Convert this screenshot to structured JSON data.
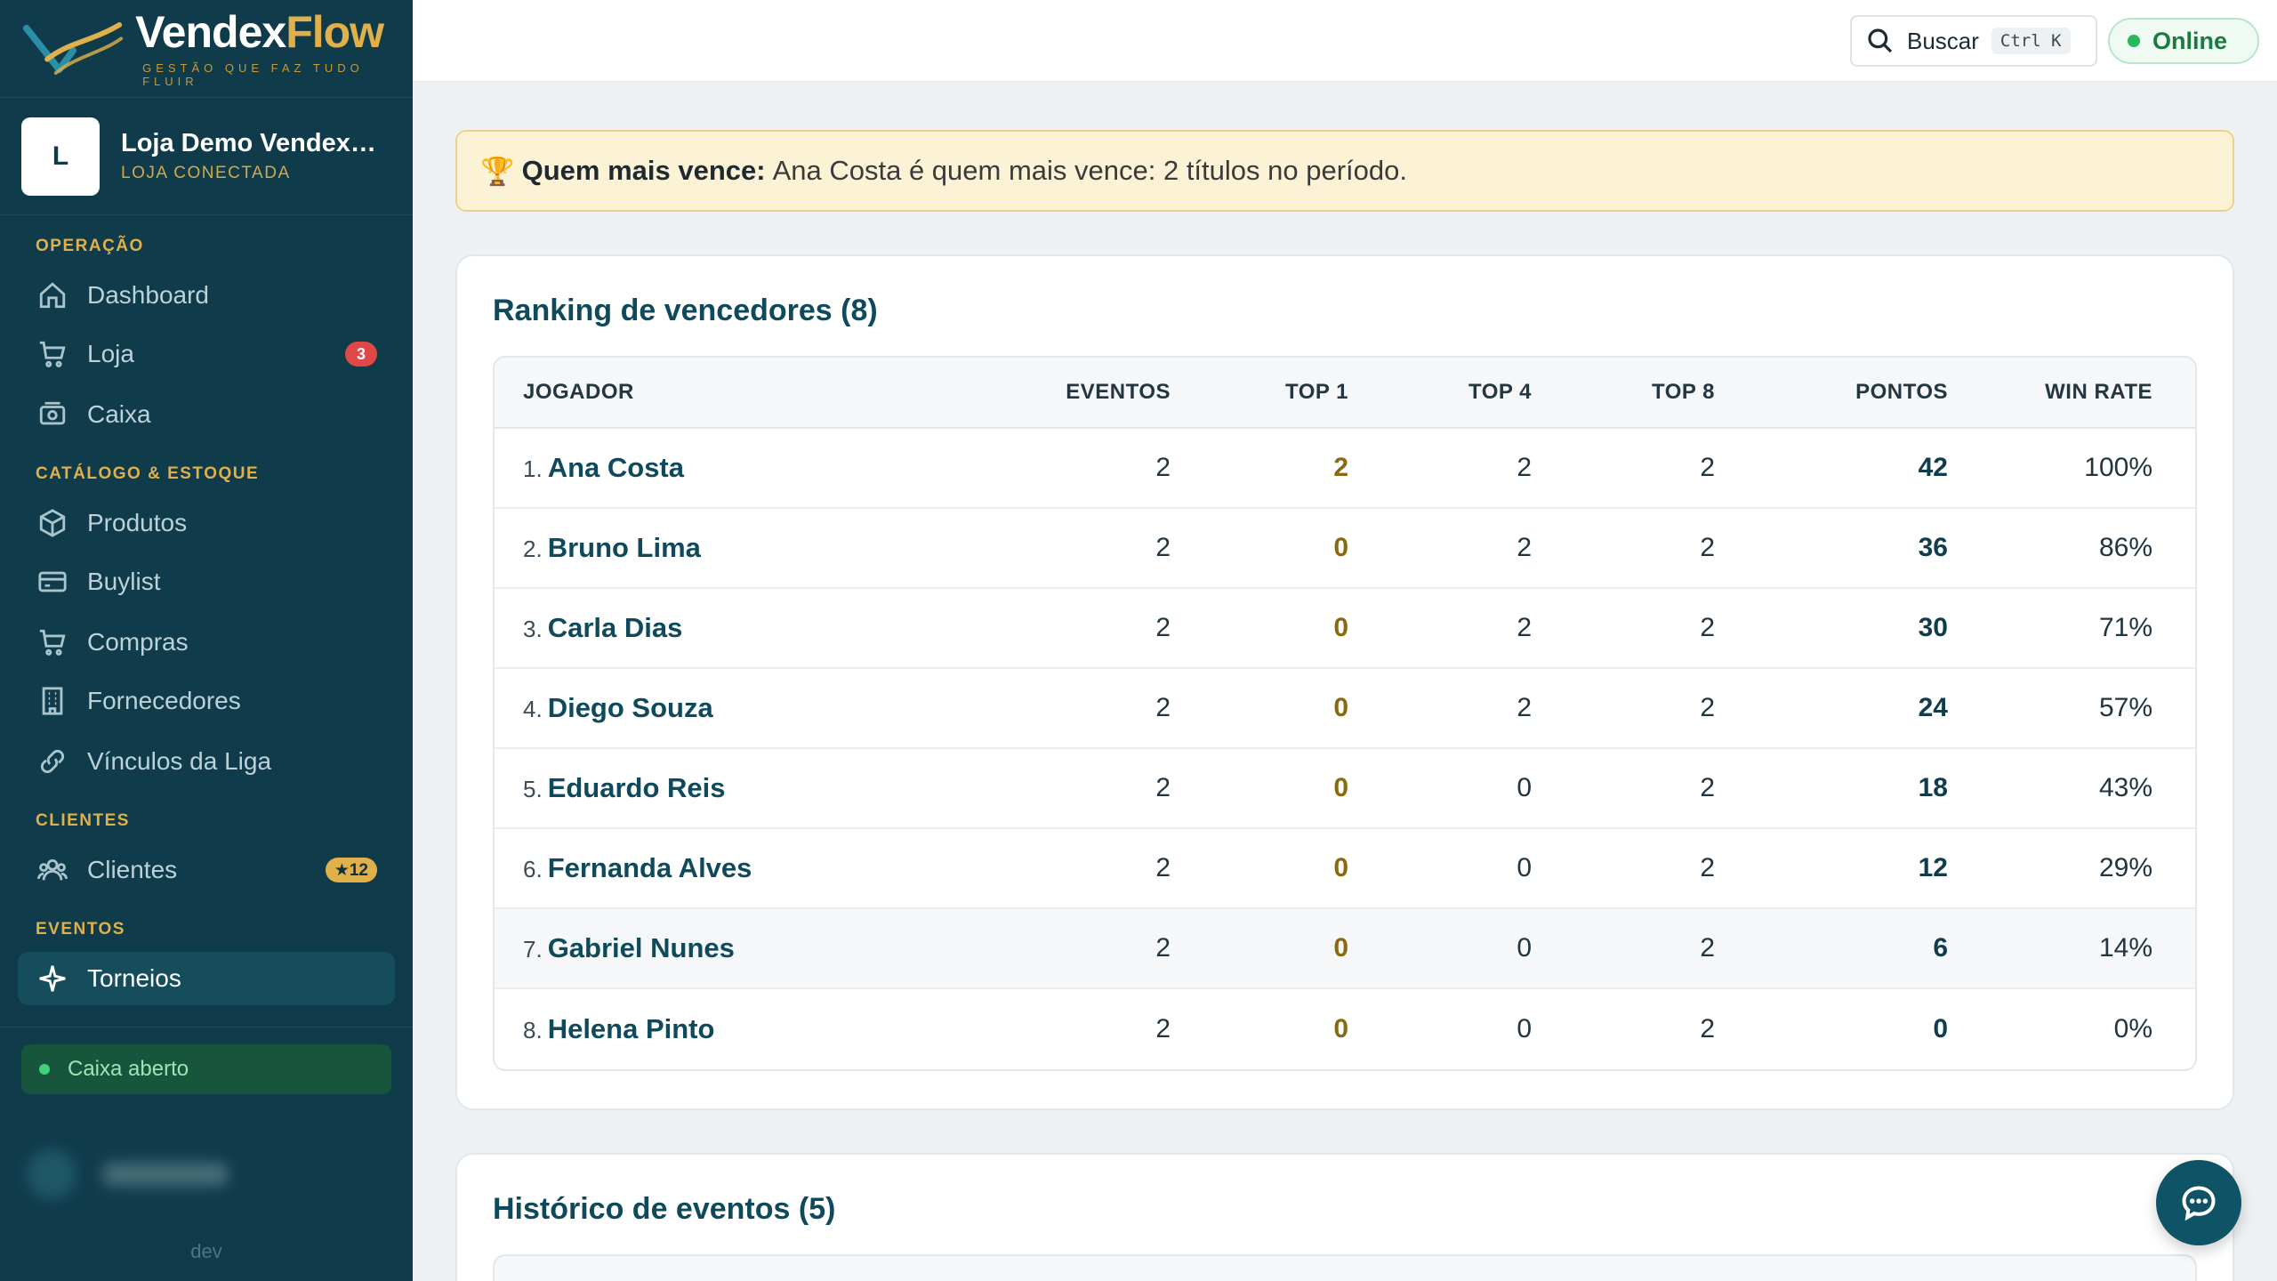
{
  "brand": {
    "name_part1": "Vendex",
    "name_part2": "Flow",
    "tagline": "GESTÃO QUE FAZ TUDO FLUIR"
  },
  "store": {
    "initial": "L",
    "name": "Loja Demo VendexFlow",
    "status": "LOJA CONECTADA"
  },
  "nav": {
    "sections": {
      "operacao": "OPERAÇÃO",
      "catalogo": "CATÁLOGO & ESTOQUE",
      "clientes": "CLIENTES",
      "eventos": "EVENTOS"
    },
    "items": {
      "dashboard": "Dashboard",
      "loja": "Loja",
      "loja_badge": "3",
      "caixa": "Caixa",
      "produtos": "Produtos",
      "buylist": "Buylist",
      "compras": "Compras",
      "fornecedores": "Fornecedores",
      "vinculos": "Vínculos da Liga",
      "clientes": "Clientes",
      "clientes_badge": "★12",
      "torneios": "Torneios"
    }
  },
  "cash_status": "Caixa aberto",
  "env_label": "dev",
  "header": {
    "search_label": "Buscar",
    "search_shortcut": "Ctrl K",
    "status": "Online"
  },
  "banner": {
    "icon": "🏆",
    "label": "Quem mais vence:",
    "text": "Ana Costa é quem mais vence: 2 títulos no período."
  },
  "ranking": {
    "title": "Ranking de vencedores (8)",
    "columns": [
      "JOGADOR",
      "EVENTOS",
      "TOP 1",
      "TOP 4",
      "TOP 8",
      "PONTOS",
      "WIN RATE"
    ],
    "rows": [
      {
        "rank": "1.",
        "name": "Ana Costa",
        "eventos": "2",
        "top1": "2",
        "top4": "2",
        "top8": "2",
        "pontos": "42",
        "winrate": "100%"
      },
      {
        "rank": "2.",
        "name": "Bruno Lima",
        "eventos": "2",
        "top1": "0",
        "top4": "2",
        "top8": "2",
        "pontos": "36",
        "winrate": "86%"
      },
      {
        "rank": "3.",
        "name": "Carla Dias",
        "eventos": "2",
        "top1": "0",
        "top4": "2",
        "top8": "2",
        "pontos": "30",
        "winrate": "71%"
      },
      {
        "rank": "4.",
        "name": "Diego Souza",
        "eventos": "2",
        "top1": "0",
        "top4": "2",
        "top8": "2",
        "pontos": "24",
        "winrate": "57%"
      },
      {
        "rank": "5.",
        "name": "Eduardo Reis",
        "eventos": "2",
        "top1": "0",
        "top4": "0",
        "top8": "2",
        "pontos": "18",
        "winrate": "43%"
      },
      {
        "rank": "6.",
        "name": "Fernanda Alves",
        "eventos": "2",
        "top1": "0",
        "top4": "0",
        "top8": "2",
        "pontos": "12",
        "winrate": "29%"
      },
      {
        "rank": "7.",
        "name": "Gabriel Nunes",
        "eventos": "2",
        "top1": "0",
        "top4": "0",
        "top8": "2",
        "pontos": "6",
        "winrate": "14%"
      },
      {
        "rank": "8.",
        "name": "Helena Pinto",
        "eventos": "2",
        "top1": "0",
        "top4": "0",
        "top8": "2",
        "pontos": "0",
        "winrate": "0%"
      }
    ]
  },
  "history": {
    "title": "Histórico de eventos (5)"
  },
  "colors": {
    "sidebar": "#0f3b4b",
    "accent_gold": "#e0b14a",
    "title_teal": "#0f4a5c",
    "online_green": "#25b85c"
  }
}
